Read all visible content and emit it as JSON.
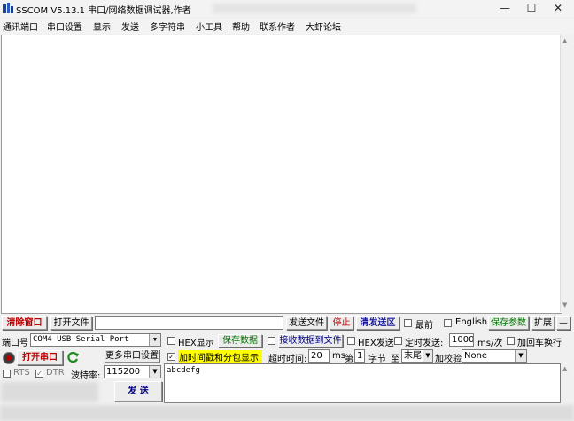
{
  "window": {
    "title": "SSCOM V5.13.1 串口/网络数据调试器,作者",
    "controls": {
      "minimize": "—",
      "maximize": "☐",
      "close": "✕"
    }
  },
  "menu": [
    "通讯端口",
    "串口设置",
    "显示",
    "发送",
    "多字符串",
    "小工具",
    "帮助",
    "联系作者",
    "大虾论坛"
  ],
  "toolbar": {
    "clear_window": "清除窗口",
    "open_file": "打开文件",
    "file_path": "",
    "send_file": "发送文件",
    "stop": "停止",
    "clear_send": "清发送区",
    "latest_label": "最前",
    "english_label": "English",
    "save_params": "保存参数",
    "expand": "扩展",
    "collapse": "—"
  },
  "port": {
    "port_label": "端口号",
    "port_value": "COM4 USB Serial Port",
    "more_ports": "更多串口设置",
    "open_port": "打开串口",
    "rts_label": "RTS",
    "dtr_label": "DTR",
    "baud_label": "波特率:",
    "baud_value": "115200"
  },
  "send_options": {
    "hex_display": "HEX显示",
    "save_data": "保存数据",
    "recv_to_file": "接收数据到文件",
    "hex_send": "HEX发送",
    "timed_send": "定时发送:",
    "interval_value": "1000",
    "interval_unit": "ms/次",
    "add_newline": "加回车换行",
    "timestamp_label": "加时间戳和分包显示.",
    "timeout_label": "超时时间:",
    "timeout_value": "20",
    "timeout_unit": "ms",
    "byte_prefix": "第",
    "byte_index": "1",
    "byte_unit": "字节",
    "to_label": "至",
    "end_value": "末尾",
    "checksum_label": "加校验",
    "checksum_value": "None",
    "send_text": "abcdefg",
    "send_button": "发 送"
  },
  "icons": {
    "app": "app-icon",
    "refresh": "refresh-icon",
    "record": "record-icon"
  },
  "colors": {
    "accent_red": "#c00000",
    "accent_green": "#007700",
    "highlight": "#ffff00"
  }
}
